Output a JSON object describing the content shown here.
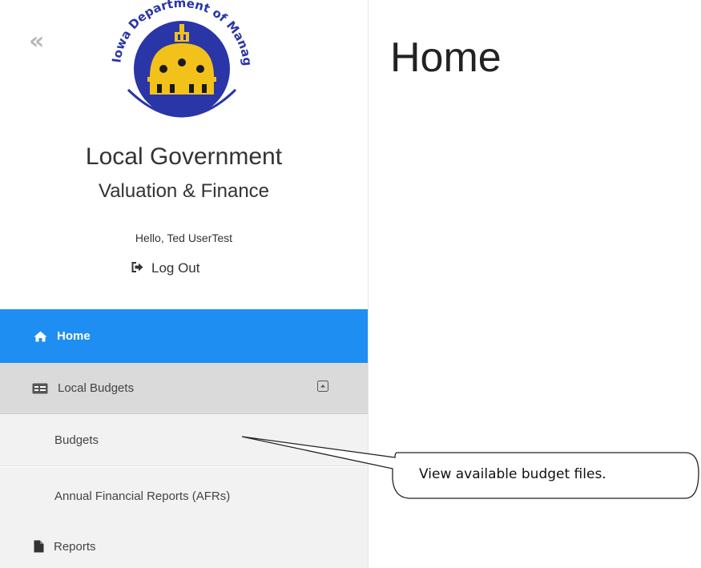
{
  "sidebar": {
    "collapse_label": "«",
    "logo_text": "Iowa Department of Management",
    "app_title": "Local Government",
    "app_subtitle": "Valuation & Finance",
    "greeting": "Hello, Ted UserTest",
    "logout_label": "Log Out",
    "nav": {
      "home": "Home",
      "local_budgets": "Local Budgets",
      "budgets": "Budgets",
      "afrs": "Annual Financial Reports (AFRs)",
      "reports": "Reports"
    }
  },
  "main": {
    "page_title": "Home"
  },
  "callout": {
    "text": "View available budget files."
  },
  "colors": {
    "active_nav": "#1e8ef2",
    "logo_blue": "#2a35a8",
    "logo_gold": "#f2c21b"
  }
}
